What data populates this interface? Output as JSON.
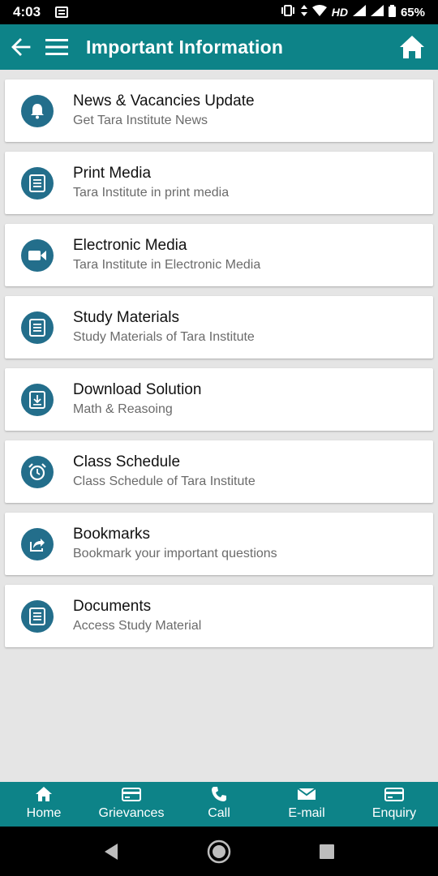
{
  "status_bar": {
    "time": "4:03",
    "network": "HD",
    "battery": "65%"
  },
  "app_bar": {
    "title": "Important Information"
  },
  "items": [
    {
      "title": "News & Vacancies Update",
      "subtitle": "Get Tara Institute News",
      "icon": "bell-icon"
    },
    {
      "title": "Print Media",
      "subtitle": "Tara Institute in print media",
      "icon": "document-icon"
    },
    {
      "title": "Electronic Media",
      "subtitle": "Tara Institute in Electronic Media",
      "icon": "videocam-icon"
    },
    {
      "title": "Study Materials",
      "subtitle": "Study Materials of Tara Institute",
      "icon": "document-icon"
    },
    {
      "title": "Download Solution",
      "subtitle": "Math & Reasoing",
      "icon": "download-icon"
    },
    {
      "title": "Class Schedule",
      "subtitle": "Class Schedule of Tara Institute",
      "icon": "alarm-clock-icon"
    },
    {
      "title": "Bookmarks",
      "subtitle": "Bookmark your important questions",
      "icon": "share-icon"
    },
    {
      "title": "Documents",
      "subtitle": "Access Study Material",
      "icon": "document-icon"
    }
  ],
  "bottom_nav": [
    {
      "label": "Home",
      "icon": "home-icon"
    },
    {
      "label": "Grievances",
      "icon": "card-icon"
    },
    {
      "label": "Call",
      "icon": "phone-icon"
    },
    {
      "label": "E-mail",
      "icon": "mail-icon"
    },
    {
      "label": "Enquiry",
      "icon": "card-icon"
    }
  ],
  "colors": {
    "primary": "#0d8388",
    "icon_circle": "#236e8b",
    "background": "#e5e5e5"
  }
}
